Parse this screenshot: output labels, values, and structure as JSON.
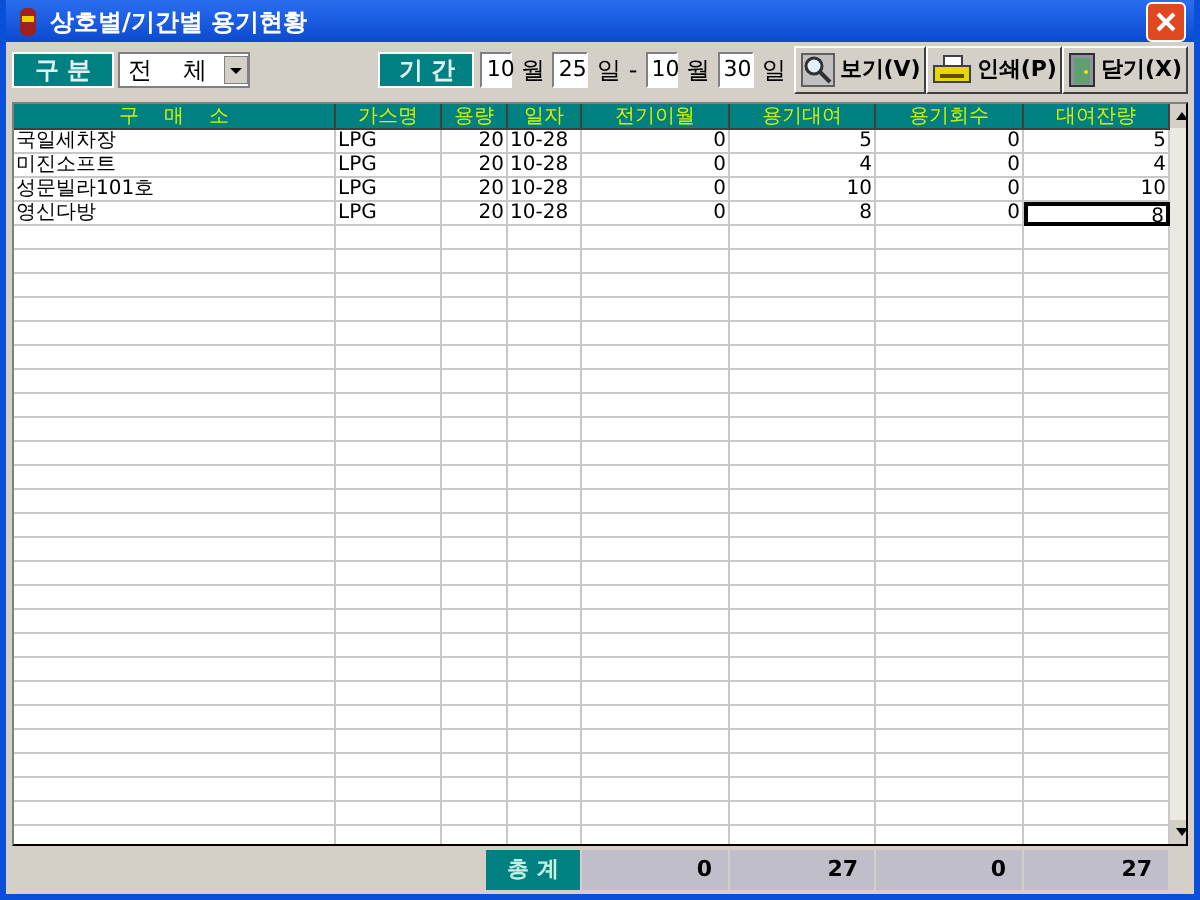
{
  "window": {
    "title": "상호별/기간별 용기현황"
  },
  "filter": {
    "label": "구 분",
    "value": "전    체"
  },
  "period": {
    "label": "기 간",
    "from_month": "10",
    "month_unit_1": "월",
    "from_day": "25",
    "day_unit_1": "일",
    "separator": "-",
    "to_month": "10",
    "month_unit_2": "월",
    "to_day": "30",
    "day_unit_2": "일"
  },
  "buttons": [
    {
      "kind": "view",
      "label": "보기(V)"
    },
    {
      "kind": "print",
      "label": "인쇄(P)"
    },
    {
      "kind": "close",
      "label": "닫기(X)"
    }
  ],
  "table": {
    "columns": [
      "구    매    소",
      "가스명",
      "용량",
      "일자",
      "전기이월",
      "용기대여",
      "용기회수",
      "대여잔량"
    ],
    "rows": [
      {
        "cells": [
          "국일세차장",
          "LPG",
          "20",
          "10-28",
          "0",
          "5",
          "0",
          "5"
        ],
        "selected": false
      },
      {
        "cells": [
          "미진소프트",
          "LPG",
          "20",
          "10-28",
          "0",
          "4",
          "0",
          "4"
        ],
        "selected": false
      },
      {
        "cells": [
          "성문빌라101호",
          "LPG",
          "20",
          "10-28",
          "0",
          "10",
          "0",
          "10"
        ],
        "selected": false
      },
      {
        "cells": [
          "영신다방",
          "LPG",
          "20",
          "10-28",
          "0",
          "8",
          "0",
          "8"
        ],
        "selected": true
      }
    ]
  },
  "totals": {
    "label": "총 계",
    "values": [
      "0",
      "27",
      "0",
      "27"
    ]
  }
}
